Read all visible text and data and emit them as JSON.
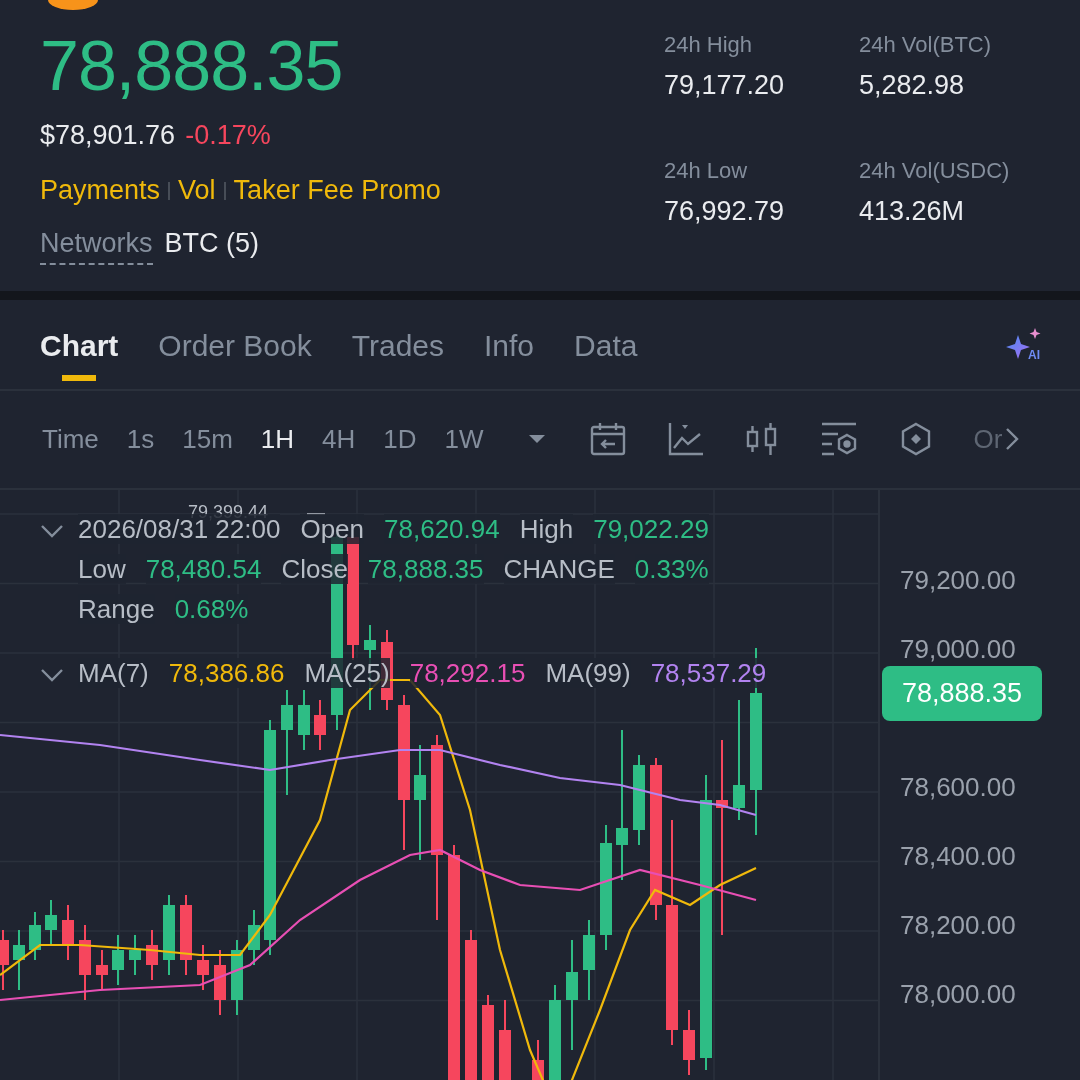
{
  "header": {
    "price": "78,888.35",
    "fiat_price": "$78,901.76",
    "change": "-0.17%",
    "links": [
      "Payments",
      "Vol",
      "Taker Fee Promo"
    ],
    "networks_label": "Networks",
    "networks_value": "BTC (5)"
  },
  "stats": [
    {
      "label": "24h High",
      "value": "79,177.20"
    },
    {
      "label": "24h Vol(BTC)",
      "value": "5,282.98"
    },
    {
      "label": "24h Low",
      "value": "76,992.79"
    },
    {
      "label": "24h Vol(USDC)",
      "value": "413.26M"
    }
  ],
  "tabs": [
    {
      "label": "Chart",
      "selected": true
    },
    {
      "label": "Order Book",
      "selected": false
    },
    {
      "label": "Trades",
      "selected": false
    },
    {
      "label": "Info",
      "selected": false
    },
    {
      "label": "Data",
      "selected": false
    }
  ],
  "intervals": [
    {
      "label": "Time",
      "selected": false
    },
    {
      "label": "1s",
      "selected": false
    },
    {
      "label": "15m",
      "selected": false
    },
    {
      "label": "1H",
      "selected": true
    },
    {
      "label": "4H",
      "selected": false
    },
    {
      "label": "1D",
      "selected": false
    },
    {
      "label": "1W",
      "selected": false
    }
  ],
  "ai_label": "AI",
  "toolbar_more": "Or",
  "chart": {
    "high_marker": "79,399.44",
    "date": "2026/08/31 22:00",
    "fields": [
      {
        "label": "Open",
        "value": "78,620.94"
      },
      {
        "label": "High",
        "value": "79,022.29"
      },
      {
        "label": "Low",
        "value": "78,480.54"
      },
      {
        "label": "Close",
        "value": "78,888.35"
      },
      {
        "label": "CHANGE",
        "value": "0.33%"
      },
      {
        "label": "Range",
        "value": "0.68%"
      }
    ],
    "moving_averages": [
      {
        "label": "MA(7)",
        "value": "78,386.86",
        "color": "#f0b90b"
      },
      {
        "label": "MA(25)",
        "value": "78,292.15",
        "color": "#e84fb4"
      },
      {
        "label": "MA(99)",
        "value": "78,537.29",
        "color": "#b283f0"
      }
    ],
    "y_axis": [
      "79,200.00",
      "79,000.00",
      "78,600.00",
      "78,400.00",
      "78,200.00",
      "78,000.00"
    ],
    "last_price": "78,888.35"
  }
}
